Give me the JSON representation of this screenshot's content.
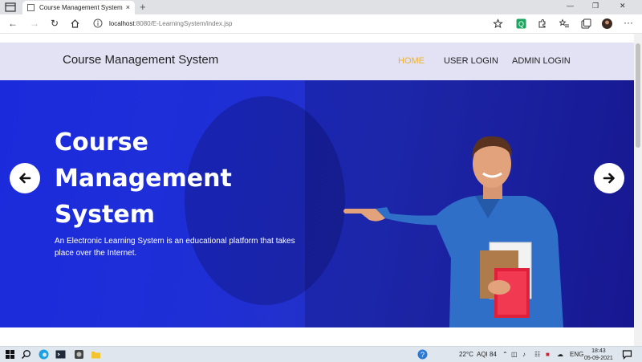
{
  "browser": {
    "tab_title": "Course Management System",
    "tab_close": "×",
    "new_tab": "+",
    "win_min": "—",
    "win_restore": "❐",
    "win_close": "✕",
    "url_host": "localhost",
    "url_rest": ":8080/E-LearningSystem/index.jsp",
    "menu": "···"
  },
  "site": {
    "brand": "Course Management System",
    "nav": [
      {
        "label": "HOME",
        "active": true
      },
      {
        "label": "USER LOGIN",
        "active": false
      },
      {
        "label": "ADMIN LOGIN",
        "active": false
      }
    ]
  },
  "hero": {
    "title_lines": [
      "Course",
      "Management",
      "System"
    ],
    "description": "An Electronic Learning System is an educational platform that takes place over the Internet."
  },
  "taskbar": {
    "temperature": "22°C",
    "aqi": "AQI 84",
    "language": "ENG",
    "time": "18:43",
    "date": "05-09-2021"
  },
  "colors": {
    "accent_active_nav": "#f0b12a",
    "hero_blue": "#1f2fd6",
    "navbar_bg": "#e3e2f5"
  }
}
